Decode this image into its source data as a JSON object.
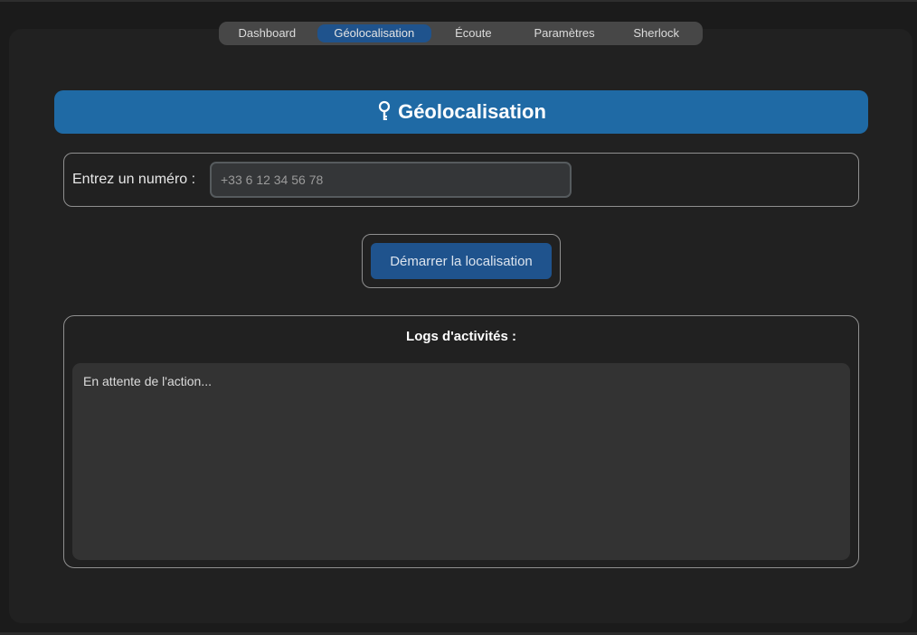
{
  "tabs": [
    {
      "label": "Dashboard",
      "active": false
    },
    {
      "label": "Géolocalisation",
      "active": true
    },
    {
      "label": "Écoute",
      "active": false
    },
    {
      "label": "Paramètres",
      "active": false
    },
    {
      "label": "Sherlock",
      "active": false
    }
  ],
  "header": {
    "title": "Géolocalisation",
    "icon": "location-pin-icon",
    "color": "#1f6aa5"
  },
  "phone_form": {
    "label": "Entrez un numéro :",
    "placeholder": "+33 6 12 34 56 78",
    "value": ""
  },
  "actions": {
    "start_label": "Démarrer la localisation"
  },
  "logs": {
    "title": "Logs d'activités :",
    "content": "En attente de l'action..."
  },
  "colors": {
    "accent": "#1f538d",
    "background": "#212121"
  }
}
